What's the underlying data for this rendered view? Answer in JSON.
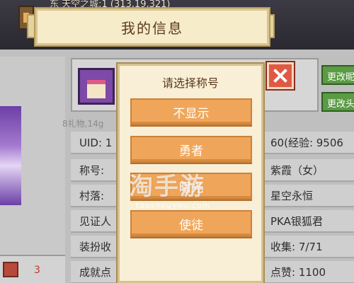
{
  "world": {
    "location_text": "东 天空之城:1 (313,19,321)"
  },
  "window": {
    "title": "我的信息"
  },
  "profile": {
    "faded_header_text": "8礼物,14g",
    "char_count": "3",
    "side_buttons": [
      "更改昵",
      "更改头"
    ],
    "rows_left": [
      "UID: 1",
      "称号:",
      "村落:",
      "见证人",
      "装扮收",
      "成就点"
    ],
    "rows_right": [
      "60(经验: 9506",
      "紫霞（女）",
      "星空永恒",
      "PKA银狐君",
      "收集: 7/71",
      "点赞: 1100"
    ]
  },
  "dialog": {
    "title": "请选择称号",
    "options": [
      "不显示",
      "勇者",
      "曙光",
      "使徒"
    ]
  },
  "watermark": {
    "main": "淘手游",
    "sub": "taoshouyou.com"
  },
  "colors": {
    "option_bg": "#f0a65a",
    "close_bg": "#e05a43",
    "side_button_bg": "#5a9b44"
  }
}
